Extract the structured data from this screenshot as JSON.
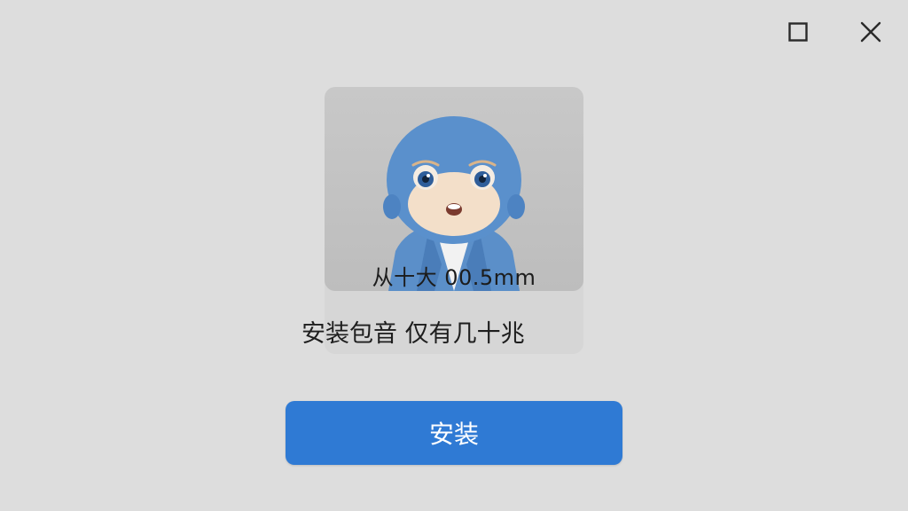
{
  "window": {
    "maximize_icon": "maximize-icon",
    "close_icon": "close-icon"
  },
  "card": {
    "image": "mascot-image",
    "caption": "从十大  00.5mm"
  },
  "subtitle": "安装包音 仅有几十兆",
  "install_button": {
    "label": "安装",
    "color": "#2f7ad4"
  }
}
